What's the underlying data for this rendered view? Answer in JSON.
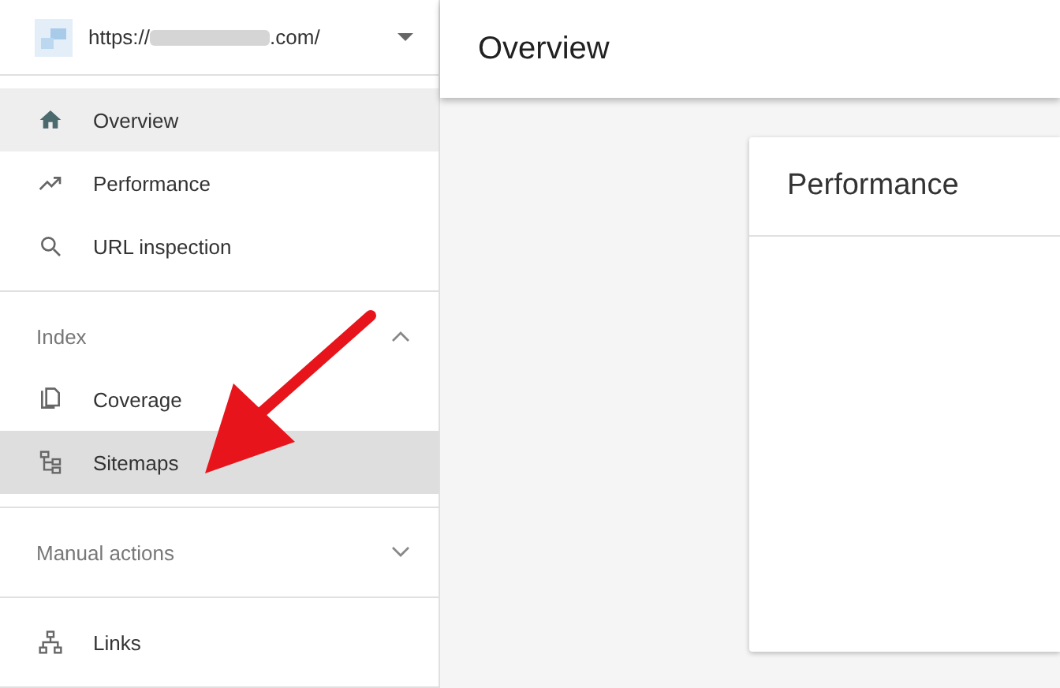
{
  "property": {
    "url_prefix": "https://",
    "url_suffix": ".com/"
  },
  "header": {
    "title": "Overview"
  },
  "sidebar": {
    "groups": [
      {
        "kind": "plain",
        "items": [
          {
            "kind": "home",
            "label": "Overview",
            "selected": true,
            "highlighted": false
          },
          {
            "kind": "trend",
            "label": "Performance",
            "selected": false,
            "highlighted": false
          },
          {
            "kind": "search",
            "label": "URL inspection",
            "selected": false,
            "highlighted": false
          }
        ]
      },
      {
        "kind": "section",
        "title": "Index",
        "expanded": true,
        "items": [
          {
            "kind": "pages",
            "label": "Coverage",
            "selected": false,
            "highlighted": false
          },
          {
            "kind": "tree",
            "label": "Sitemaps",
            "selected": false,
            "highlighted": true
          }
        ]
      },
      {
        "kind": "section",
        "title": "Manual actions",
        "expanded": false
      },
      {
        "kind": "plain",
        "items": [
          {
            "kind": "network",
            "label": "Links",
            "selected": false,
            "highlighted": false
          }
        ]
      }
    ]
  },
  "card": {
    "title": "Performance"
  }
}
